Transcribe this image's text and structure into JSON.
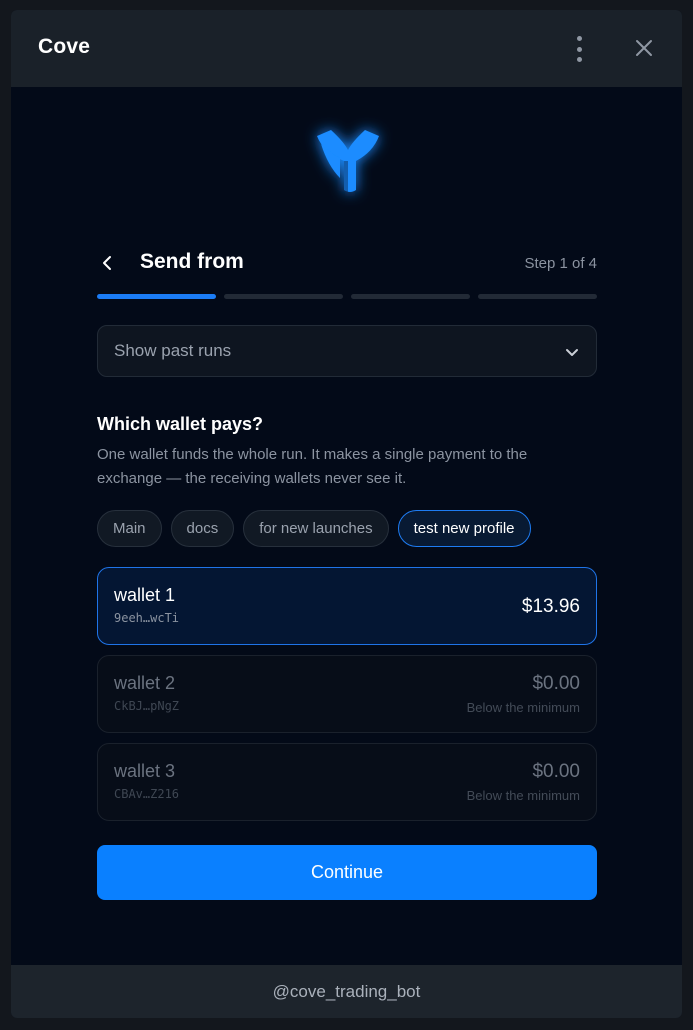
{
  "window": {
    "title": "Cove"
  },
  "header": {
    "menu_icon": "kebab-menu-icon",
    "close_icon": "close-icon"
  },
  "logo": {
    "icon": "cove-logo-icon",
    "color": "#1a8cff"
  },
  "step": {
    "title": "Send from",
    "counter": "Step 1 of 4",
    "current": 1,
    "total": 4
  },
  "past_runs": {
    "label": "Show past runs"
  },
  "question": {
    "title": "Which wallet pays?",
    "description": "One wallet funds the whole run. It makes a single payment to the exchange — the receiving wallets never see it."
  },
  "profiles": [
    {
      "label": "Main",
      "active": false
    },
    {
      "label": "docs",
      "active": false
    },
    {
      "label": "for new launches",
      "active": false
    },
    {
      "label": "test new profile",
      "active": true
    }
  ],
  "wallets": [
    {
      "name": "wallet 1",
      "address": "9eeh…wcTi",
      "balance": "$13.96",
      "note": "",
      "selected": true
    },
    {
      "name": "wallet 2",
      "address": "CkBJ…pNgZ",
      "balance": "$0.00",
      "note": "Below the minimum",
      "selected": false
    },
    {
      "name": "wallet 3",
      "address": "CBAv…Z216",
      "balance": "$0.00",
      "note": "Below the minimum",
      "selected": false
    }
  ],
  "actions": {
    "continue_label": "Continue"
  },
  "footer": {
    "handle": "@cove_trading_bot"
  },
  "colors": {
    "accent": "#0a80ff",
    "background": "#030a18",
    "titlebar": "#1a2129"
  }
}
